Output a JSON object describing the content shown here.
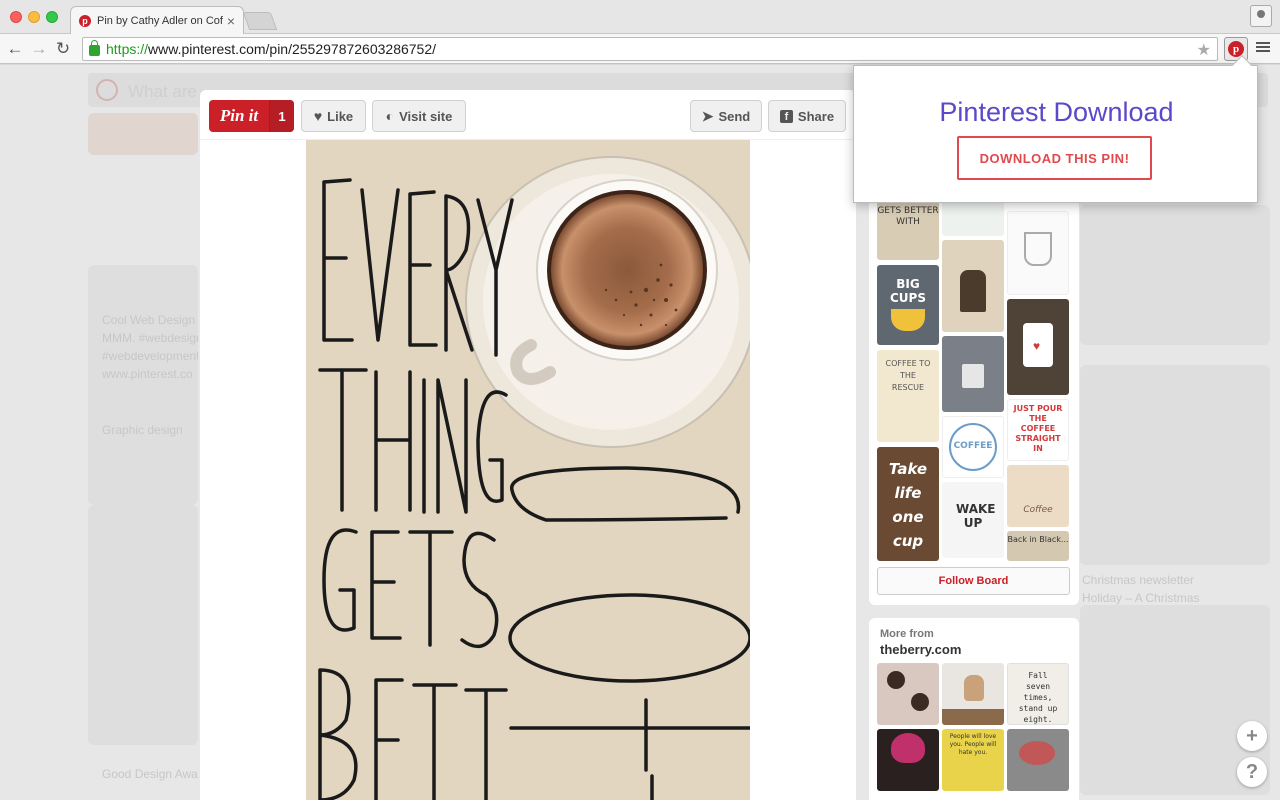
{
  "browser": {
    "tab_title": "Pin by Cathy Adler on Coff",
    "tab_close": "×",
    "url_scheme": "https://",
    "url_rest": "www.pinterest.com/pin/255297872603286752/",
    "back_icon": "←",
    "forward_icon": "→",
    "reload_icon": "↻",
    "star_icon": "★"
  },
  "pin_actions": {
    "pin_it": "Pin it",
    "pin_count": "1",
    "like": "Like",
    "visit_site": "Visit site",
    "send": "Send",
    "share": "Share"
  },
  "pin_image": {
    "words": [
      "EVERY",
      "THING",
      "GETS",
      "BETTER"
    ]
  },
  "board": {
    "thumb_texts": [
      "GETS BETTER WITH",
      "BIG CUPS",
      "COFFEE TO THE RESCUE",
      "Take life one cup",
      "COFFEE",
      "WAKE UP",
      "JUST POUR THE COFFEE STRAIGHT IN",
      "Coffee",
      "Back in Black..."
    ],
    "follow_label": "Follow Board"
  },
  "more_from": {
    "label": "More from",
    "site": "theberry.com",
    "thumb_texts": [
      "Fall seven times, stand up eight.",
      "People will love you. People will hate you."
    ]
  },
  "popup": {
    "title": "Pinterest Download",
    "button": "DOWNLOAD THIS PIN!"
  },
  "background": {
    "search_ghost": "What are",
    "text_lines": [
      "Cool Web Design",
      "MMM. #webdesign",
      "#webdevelopment",
      "www.pinterest.co",
      "Good Design Awa",
      "Graphic design",
      "Christmas newsletter",
      "Holiday – A Christmas"
    ]
  },
  "floating": {
    "plus": "+",
    "help": "?"
  },
  "colors": {
    "pinterest_red": "#cb2027",
    "popup_title": "#5a49c9",
    "popup_button": "#e0494d"
  }
}
